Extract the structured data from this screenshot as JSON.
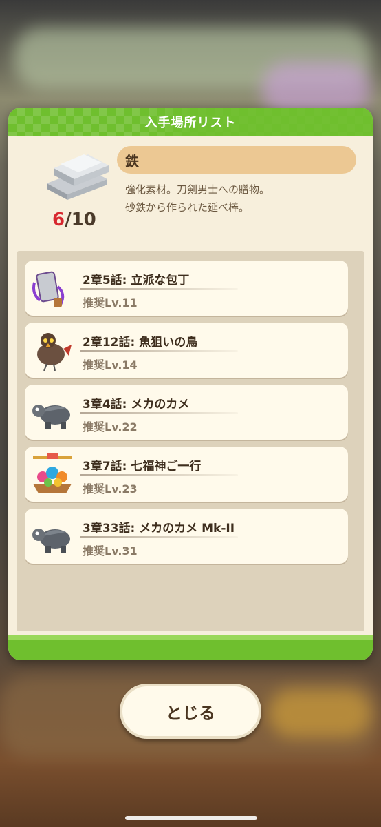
{
  "modal": {
    "title": "入手場所リスト"
  },
  "item": {
    "name": "鉄",
    "count_current": "6",
    "count_sep_max": "/10",
    "description_line1": "強化素材。刀剣男士への贈物。",
    "description_line2": "砂鉄から作られた延べ棒。",
    "icon": "iron-ingot-icon"
  },
  "locations": [
    {
      "title": "2章5話: 立派な包丁",
      "level": "推奨Lv.11",
      "icon": "knife-monster-icon"
    },
    {
      "title": "2章12話: 魚狙いの鳥",
      "level": "推奨Lv.14",
      "icon": "bird-monster-icon"
    },
    {
      "title": "3章4話: メカのカメ",
      "level": "推奨Lv.22",
      "icon": "mecha-turtle-icon"
    },
    {
      "title": "3章7話: 七福神ご一行",
      "level": "推奨Lv.23",
      "icon": "treasure-ship-icon"
    },
    {
      "title": "3章33話: メカのカメ Mk-II",
      "level": "推奨Lv.31",
      "icon": "mecha-turtle-icon"
    }
  ],
  "close_button": {
    "label": "とじる"
  },
  "colors": {
    "header_green": "#6fbf2e",
    "panel_bg": "#f7efdc",
    "name_pill": "#ecc893",
    "count_red": "#d7282f"
  }
}
